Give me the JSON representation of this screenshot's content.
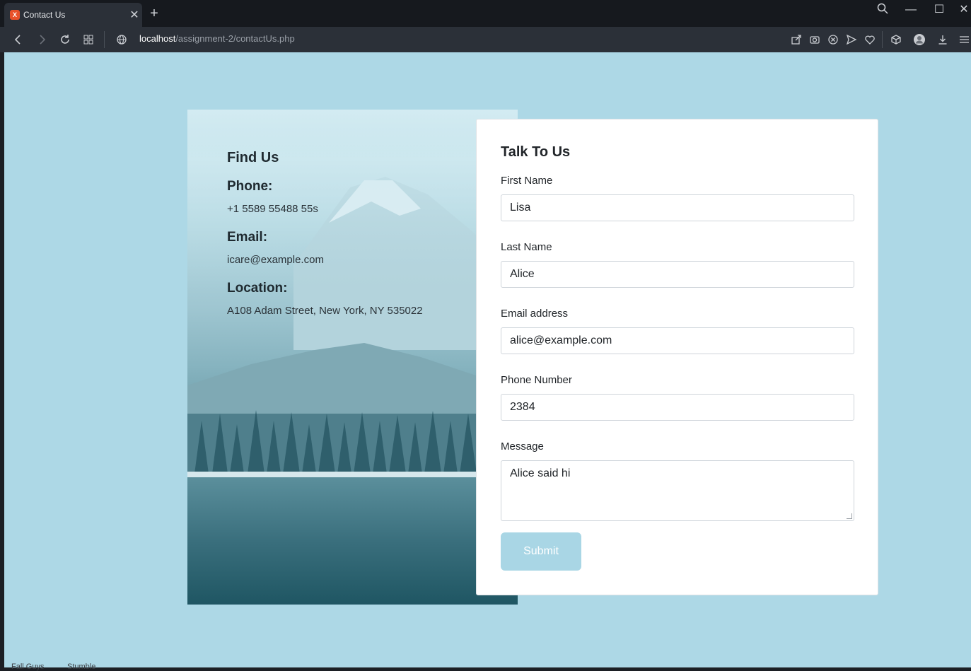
{
  "browser": {
    "tab_title": "Contact Us",
    "favicon_text": "X",
    "tab_close_icon": "close-icon",
    "url_host": "localhost",
    "url_path": "/assignment-2/contactUs.php"
  },
  "find_us": {
    "title": "Find Us",
    "phone_label": "Phone:",
    "phone_value": "+1 5589 55488 55s",
    "email_label": "Email:",
    "email_value": "icare@example.com",
    "location_label": "Location:",
    "location_value": "A108 Adam Street, New York, NY 535022"
  },
  "form": {
    "title": "Talk To Us",
    "first_name_label": "First Name",
    "first_name_value": "Lisa",
    "last_name_label": "Last Name",
    "last_name_value": "Alice",
    "email_label": "Email address",
    "email_value": "alice@example.com",
    "phone_label": "Phone Number",
    "phone_value": "2384",
    "message_label": "Message",
    "message_value": "Alice said hi",
    "submit_label": "Submit"
  },
  "colors": {
    "page_background": "#add8e6",
    "submit_button": "#a9d6e5",
    "chrome_dark": "#2b3038"
  },
  "bottom_bar": {
    "item1": "Fall Guys",
    "item2": "Stumble"
  }
}
